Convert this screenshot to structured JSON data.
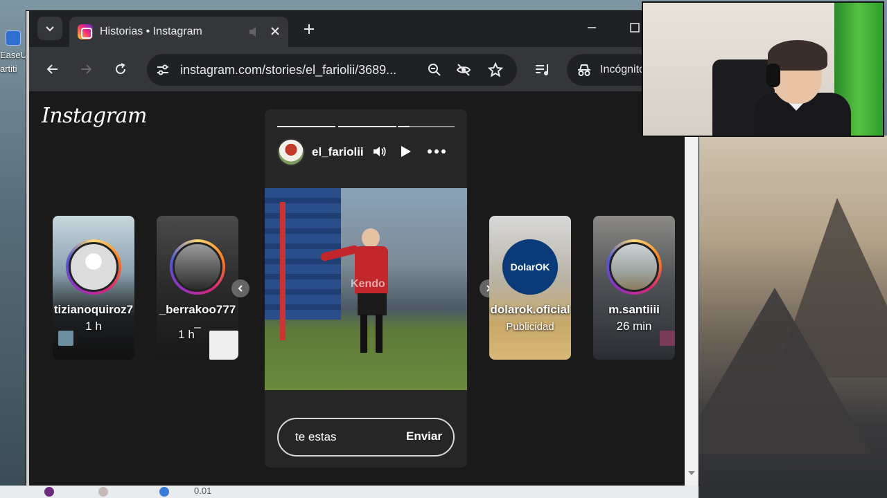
{
  "desktop": {
    "labels": [
      "EaseU",
      "artiti"
    ]
  },
  "browser": {
    "tab": {
      "title": "Historias • Instagram"
    },
    "address": {
      "url": "instagram.com/stories/el_fariolii/3689..."
    },
    "incognito_label": "Incógnito"
  },
  "instagram": {
    "logo": "Instagram",
    "story": {
      "username": "el_fariolii",
      "watermark": "Kendo",
      "reply": {
        "value": "te estas",
        "send_label": "Enviar"
      }
    },
    "cards": [
      {
        "name": "tizianoquiroz7",
        "time": "1 h"
      },
      {
        "name": "_berrakoo777",
        "extra": "_",
        "time": "1 h"
      },
      {
        "name": "dolarok.oficial",
        "sub": "Publicidad",
        "avatar_text": "DolarOK"
      },
      {
        "name": "m.santiiii",
        "time": "26 min"
      }
    ]
  },
  "taskbar": {
    "text": "0.01"
  },
  "colors": {
    "chrome_dark": "#202124",
    "chrome_toolbar": "#35363a",
    "ig_background": "#1a1a1a",
    "dolarok_blue": "#0b3a78"
  }
}
